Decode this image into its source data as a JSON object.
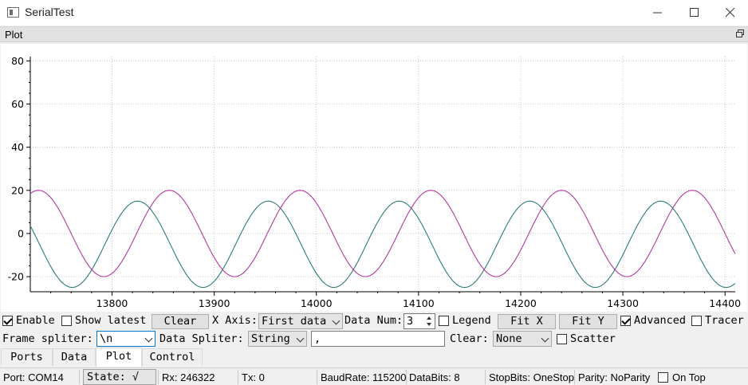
{
  "window": {
    "title": "SerialTest"
  },
  "dock": {
    "title": "Plot"
  },
  "chart_data": {
    "type": "line",
    "x_range": [
      13720,
      14410
    ],
    "ylim": [
      -27,
      82
    ],
    "x_ticks": [
      13800,
      13900,
      14000,
      14100,
      14200,
      14300,
      14400
    ],
    "y_ticks": [
      -20,
      0,
      20,
      40,
      60,
      80
    ],
    "x_tick_labels": [
      "13800",
      "13900",
      "14000",
      "14100",
      "14200",
      "14300",
      "14400"
    ],
    "y_tick_labels": [
      "-20",
      "0",
      "20",
      "40",
      "60",
      "80"
    ],
    "grid": true,
    "legend": false,
    "series": [
      {
        "color": "#2f7a7a",
        "amplitude": 20,
        "offset": -5,
        "period": 128,
        "peak_x": 13825
      },
      {
        "color": "#b03aa0",
        "amplitude": 20,
        "offset": 0,
        "period": 128,
        "peak_x": 13856
      }
    ]
  },
  "controls": {
    "enable_label": "Enable",
    "enable_checked": true,
    "show_latest_label": "Show latest",
    "show_latest_checked": false,
    "clear_button": "Clear",
    "x_axis_label": "X Axis:",
    "x_axis_value": "First data",
    "data_num_label": "Data Num:",
    "data_num_value": "3",
    "legend_label": "Legend",
    "legend_checked": false,
    "fit_x_button": "Fit X",
    "fit_y_button": "Fit Y",
    "advanced_label": "Advanced",
    "advanced_checked": true,
    "tracer_label": "Tracer",
    "tracer_checked": false,
    "frame_splitter_label": "Frame spliter:",
    "frame_splitter_value": "\\n",
    "data_splitter_label": "Data Spliter:",
    "data_splitter_type": "String",
    "data_splitter_value": ",",
    "clear_label": "Clear:",
    "clear_value": "None",
    "scatter_label": "Scatter",
    "scatter_checked": false
  },
  "tabs": [
    {
      "label": "Ports",
      "active": false
    },
    {
      "label": "Data",
      "active": false
    },
    {
      "label": "Plot",
      "active": true
    },
    {
      "label": "Control",
      "active": false
    }
  ],
  "status": {
    "port": "Port: COM14",
    "state": "State: √",
    "rx": "Rx: 246322",
    "tx": "Tx: 0",
    "baudrate": "BaudRate: 115200",
    "databits": "DataBits: 8",
    "stopbits": "StopBits: OneStop",
    "parity": "Parity: NoParity",
    "on_top_label": "On Top",
    "on_top_checked": false
  }
}
